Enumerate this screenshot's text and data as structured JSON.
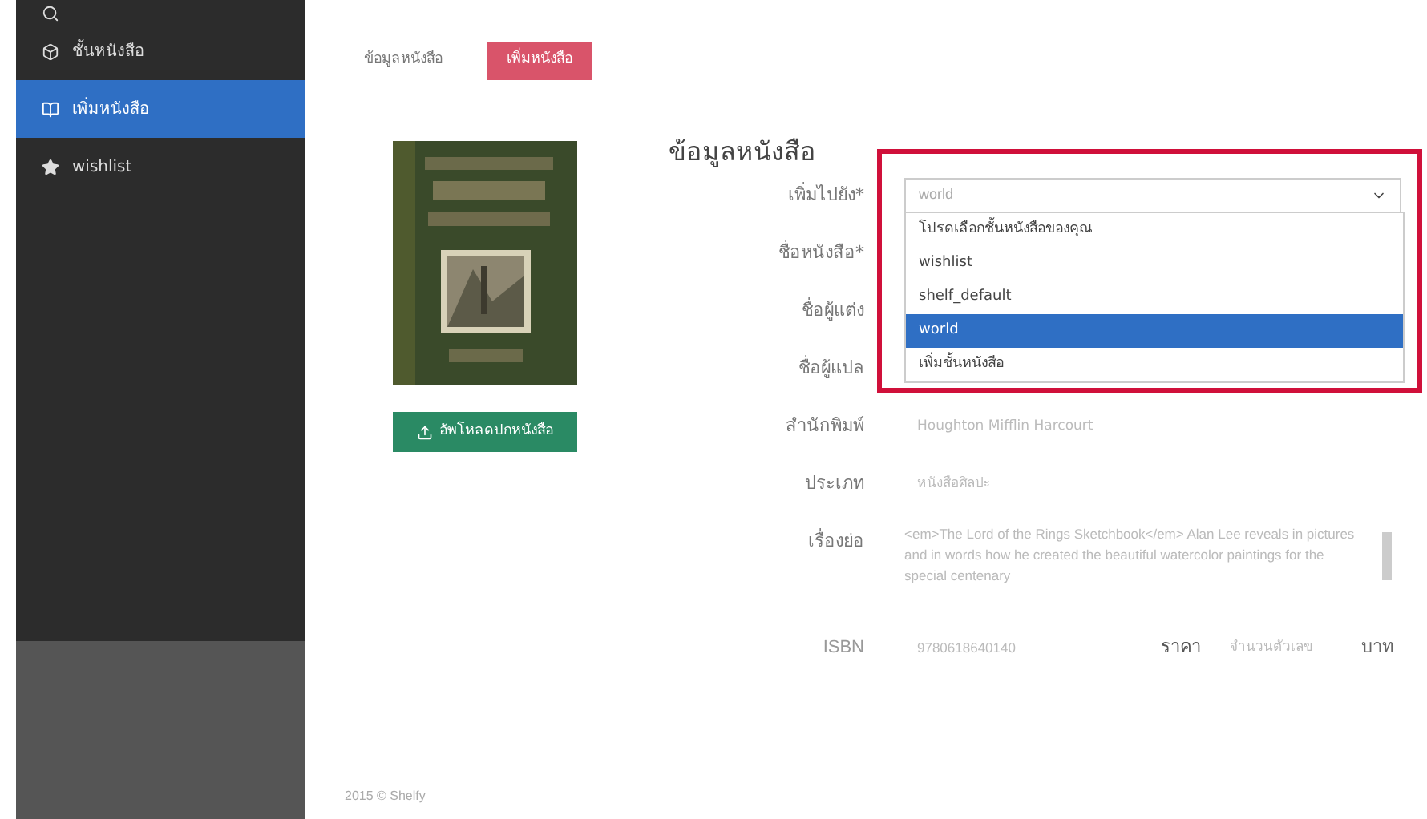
{
  "sidebar": {
    "items": [
      {
        "label": "ชั้นหนังสือ",
        "selected": false
      },
      {
        "label": "เพิ่มหนังสือ",
        "selected": true
      },
      {
        "label": "wishlist",
        "selected": false
      }
    ]
  },
  "tabs": [
    {
      "label": "ข้อมูลหนังสือ",
      "selected": false
    },
    {
      "label": "เพิ่มหนังสือ",
      "selected": true
    }
  ],
  "cover": {
    "upload_button": "อัพโหลดปกหนังสือ"
  },
  "form": {
    "title": "ข้อมูลหนังสือ",
    "fields": [
      {
        "label": "เพิ่มไปยัง*",
        "kind": "select",
        "value": "world",
        "expanded": true,
        "options": [
          {
            "label": "โปรดเลือกชั้นหนังสือของคุณ",
            "selected": false
          },
          {
            "label": "wishlist",
            "selected": false
          },
          {
            "label": "shelf_default",
            "selected": false
          },
          {
            "label": "world",
            "selected": true
          },
          {
            "label": "เพิ่มชั้นหนังสือ",
            "selected": false
          }
        ]
      },
      {
        "label": "ชื่อหนังสือ*",
        "kind": "text"
      },
      {
        "label": "ชื่อผู้แต่ง",
        "kind": "text"
      },
      {
        "label": "ชื่อผู้แปล",
        "kind": "text"
      },
      {
        "label": "สำนักพิมพ์",
        "kind": "text",
        "value": "Houghton Mifflin Harcourt"
      },
      {
        "label": "ประเภท",
        "kind": "text",
        "value": "หนังสือศิลปะ"
      },
      {
        "label": "เรื่องย่อ",
        "kind": "textarea",
        "value": "<em>The Lord of the Rings Sketchbook</em> Alan Lee reveals in pictures and in words how he created the beautiful watercolor paintings for the special centenary"
      }
    ],
    "isbn": {
      "label": "ISBN",
      "value": "9780618640140"
    },
    "price": {
      "label": "ราคา",
      "placeholder": "จำนวนตัวเลข",
      "unit": "บาท"
    }
  },
  "footer": "2015 © Shelfy"
}
